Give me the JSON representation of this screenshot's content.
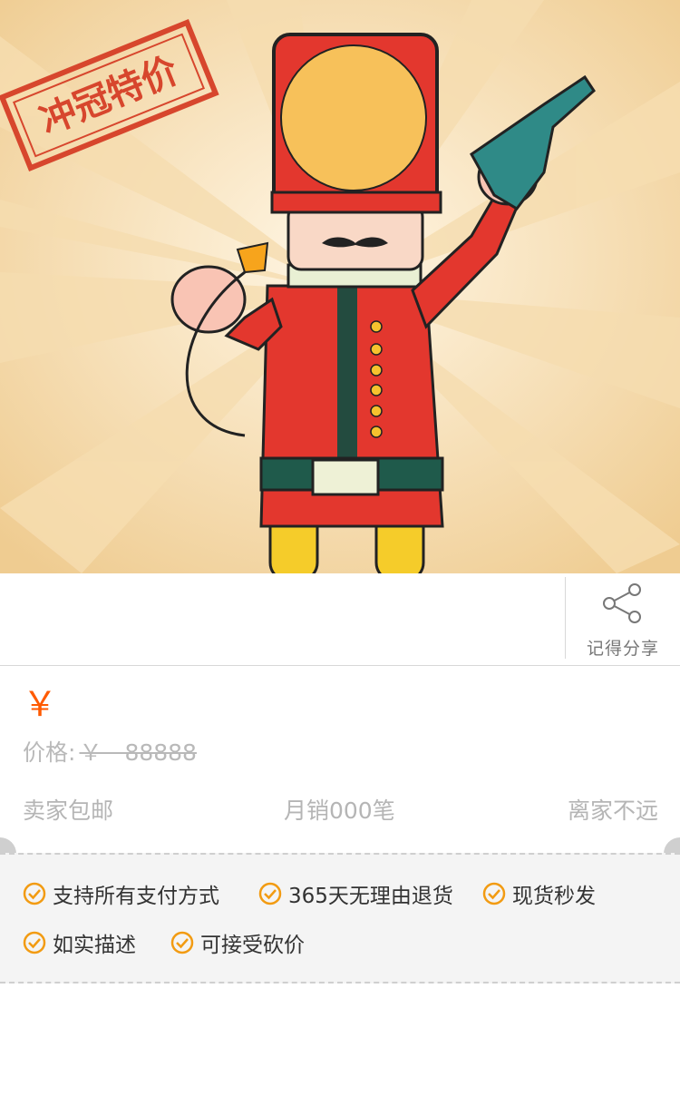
{
  "hero": {
    "stamp_text": "冲冠特价",
    "colors": {
      "background": "#f2d7a6",
      "uniform": "#e3372e",
      "hat_badge": "#f7c15a",
      "gun": "#2f8a87"
    }
  },
  "share": {
    "label": "记得分享",
    "icon": "share-icon"
  },
  "price": {
    "currency": "￥",
    "original_label": "价格:",
    "original_value": "￥　88888",
    "accent_color": "#ff5a00"
  },
  "stats": {
    "shipping": "卖家包邮",
    "monthly_sales": "月销000笔",
    "distance": "离家不远"
  },
  "guarantees": [
    {
      "label": "支持所有支付方式",
      "icon": "check-circle-icon"
    },
    {
      "label": "365天无理由退货",
      "icon": "check-circle-icon"
    },
    {
      "label": "现货秒发",
      "icon": "check-circle-icon"
    },
    {
      "label": "如实描述",
      "icon": "check-circle-icon"
    },
    {
      "label": "可接受砍价",
      "icon": "check-circle-icon"
    }
  ]
}
